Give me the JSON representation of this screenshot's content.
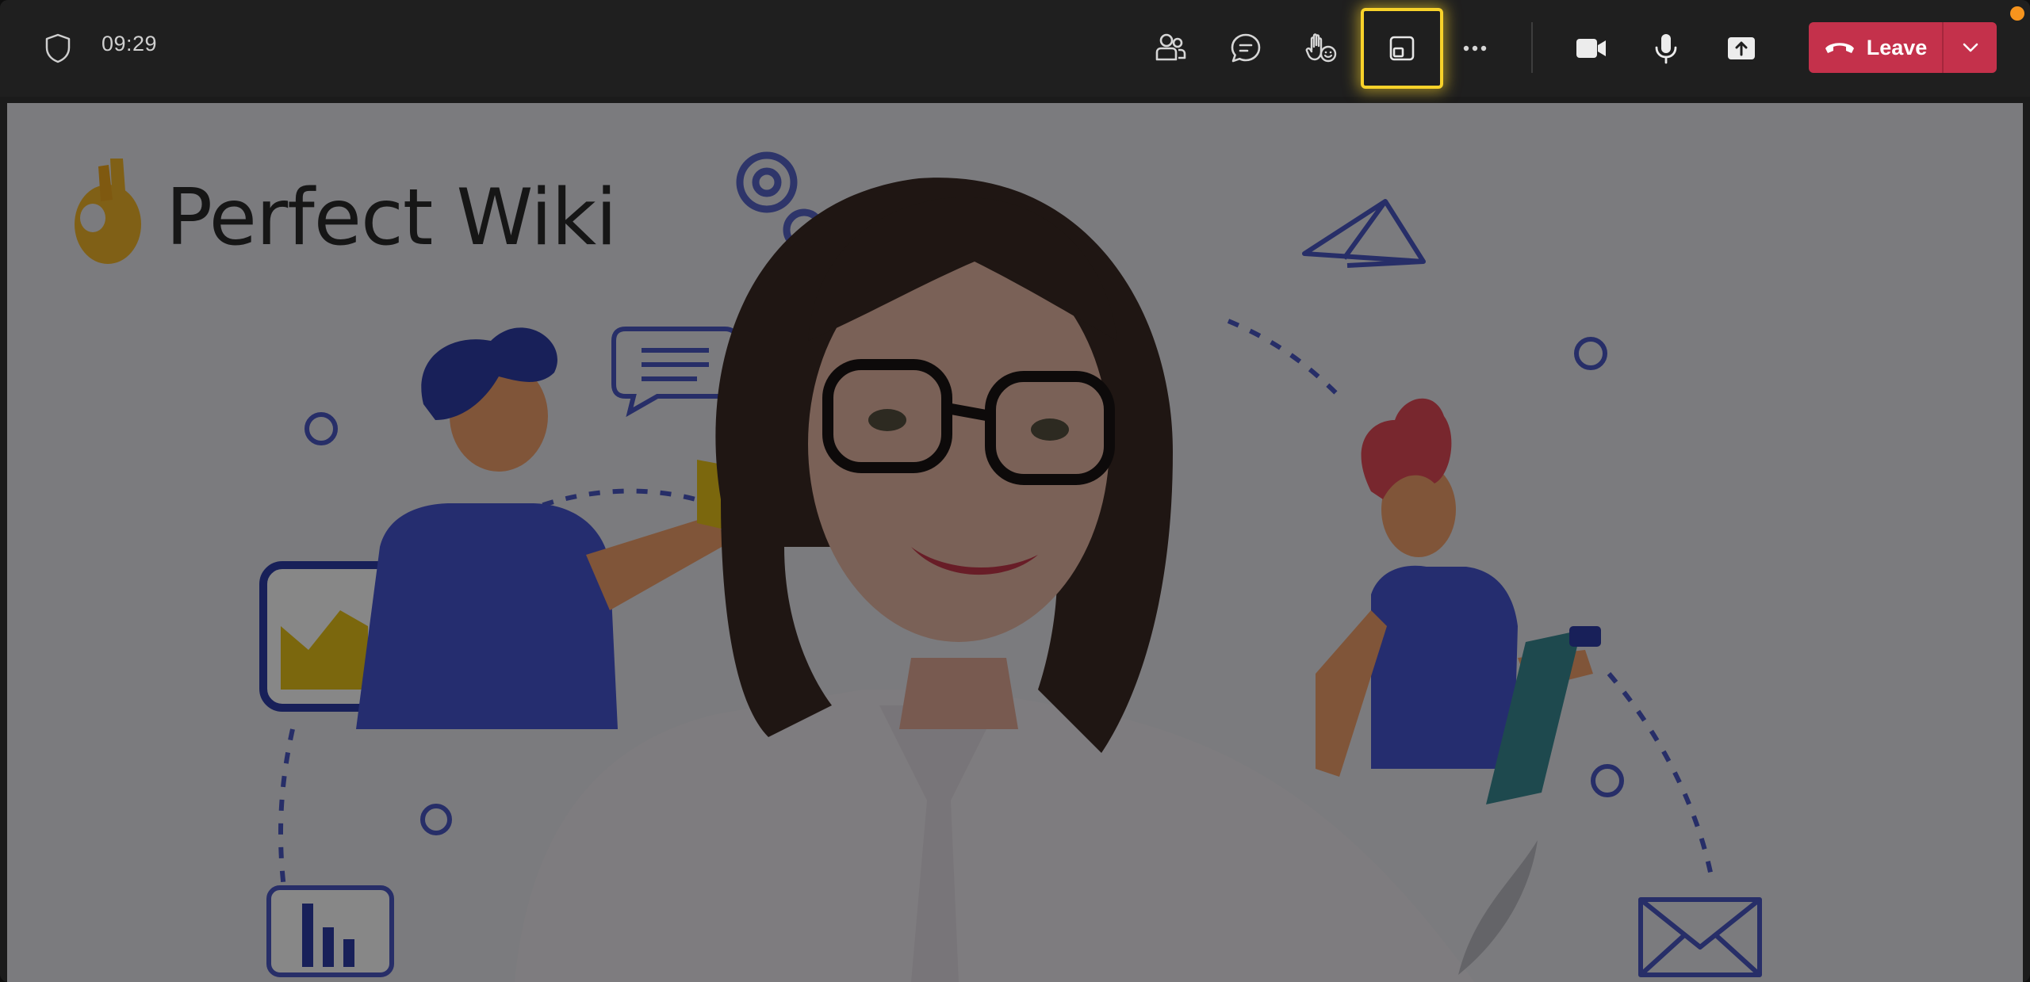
{
  "meeting": {
    "timer": "09:29",
    "leave_label": "Leave"
  },
  "controls": [
    {
      "name": "people-button",
      "icon": "people-icon"
    },
    {
      "name": "chat-button",
      "icon": "chat-icon"
    },
    {
      "name": "react-button",
      "icon": "raise-hand-icon"
    },
    {
      "name": "view-button",
      "icon": "pop-out-icon",
      "highlighted": true
    },
    {
      "name": "more-button",
      "icon": "more-icon"
    },
    {
      "name": "camera-button",
      "icon": "camera-icon"
    },
    {
      "name": "mic-button",
      "icon": "mic-icon"
    },
    {
      "name": "share-button",
      "icon": "share-icon"
    }
  ],
  "background": {
    "brand_text": "Perfect Wiki"
  },
  "colors": {
    "bar": "#1f1f1f",
    "leave": "#c4314b",
    "highlight": "#f8d22a",
    "brand_blue": "#3f4fbf",
    "folder_yellow": "#e9c319",
    "notification": "#f7941d"
  }
}
